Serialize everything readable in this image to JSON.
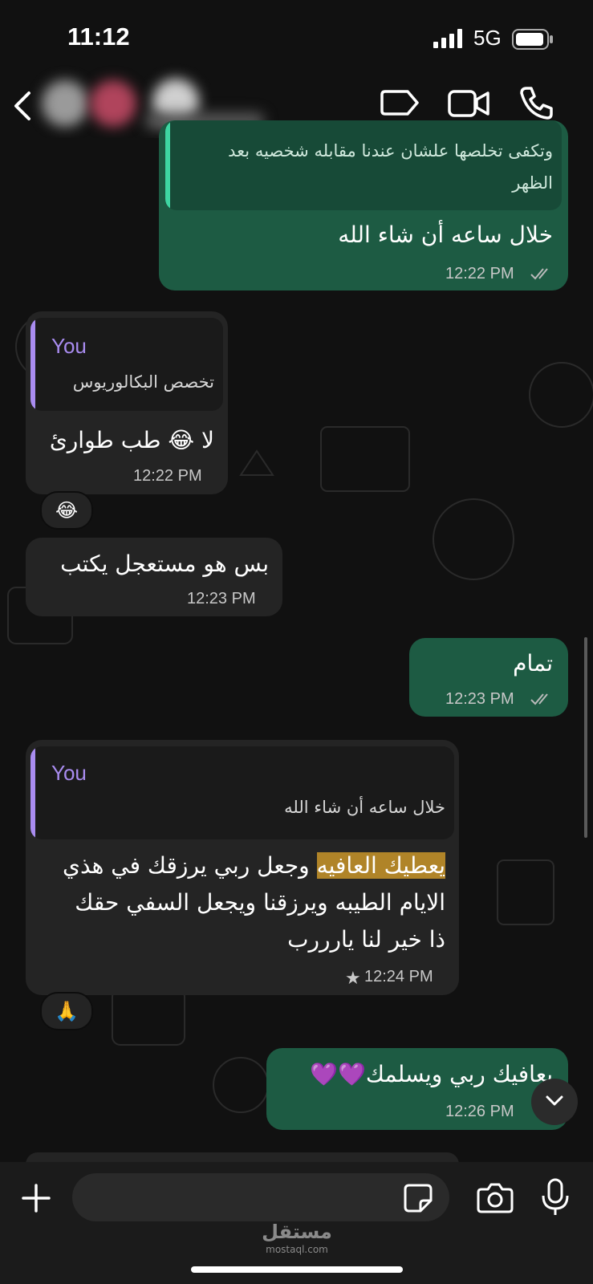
{
  "status_bar": {
    "time": "11:12",
    "network": "5G"
  },
  "header": {
    "icons": [
      "back-icon",
      "label-icon",
      "video-call-icon",
      "voice-call-icon"
    ]
  },
  "messages": [
    {
      "id": "m1",
      "direction": "outgoing",
      "quote_partial": "وتكفى تخلصها علشان عندنا مقابله شخصيه بعد",
      "quote_partial_2": "الظهر",
      "text": "خلال ساعه أن شاء الله",
      "time": "12:22 PM",
      "status": "read"
    },
    {
      "id": "m2",
      "direction": "incoming",
      "quote_name": "You",
      "quote_text": "تخصص البكالوريوس",
      "text": "لا 😂 طب طوارئ",
      "time": "12:22 PM",
      "reaction": "😂"
    },
    {
      "id": "m3",
      "direction": "incoming",
      "text": "بس هو مستعجل يكتب",
      "time": "12:23 PM"
    },
    {
      "id": "m4",
      "direction": "outgoing",
      "text": "تمام",
      "time": "12:23 PM",
      "status": "read"
    },
    {
      "id": "m5",
      "direction": "incoming",
      "quote_name": "You",
      "quote_text": "خلال ساعه أن شاء الله",
      "highlight": "يعطيك العافيه",
      "line1_rest": " وجعل ربي يرزقك في هذي",
      "line2": "الايام الطيبه ويرزقنا ويجعل السفي حقك",
      "line3": "ذا خير لنا يارررب",
      "star": "★",
      "time": "12:24 PM",
      "reaction": "🙏"
    },
    {
      "id": "m6",
      "direction": "outgoing",
      "text": "يعافيك ربي ويسلمك💜💜",
      "time": "12:26 PM",
      "status": "read"
    }
  ],
  "composer": {
    "icons": [
      "plus-icon",
      "sticker-icon",
      "camera-icon",
      "microphone-icon"
    ]
  },
  "watermark": {
    "arabic": "مستقل",
    "latin": "mostaql.com"
  },
  "colors": {
    "outgoing": "#1d5b43",
    "incoming": "#242424",
    "quote_bar_in": "#a98cf0",
    "quote_bar_out": "#3ed6a2",
    "highlight": "#b08428"
  }
}
